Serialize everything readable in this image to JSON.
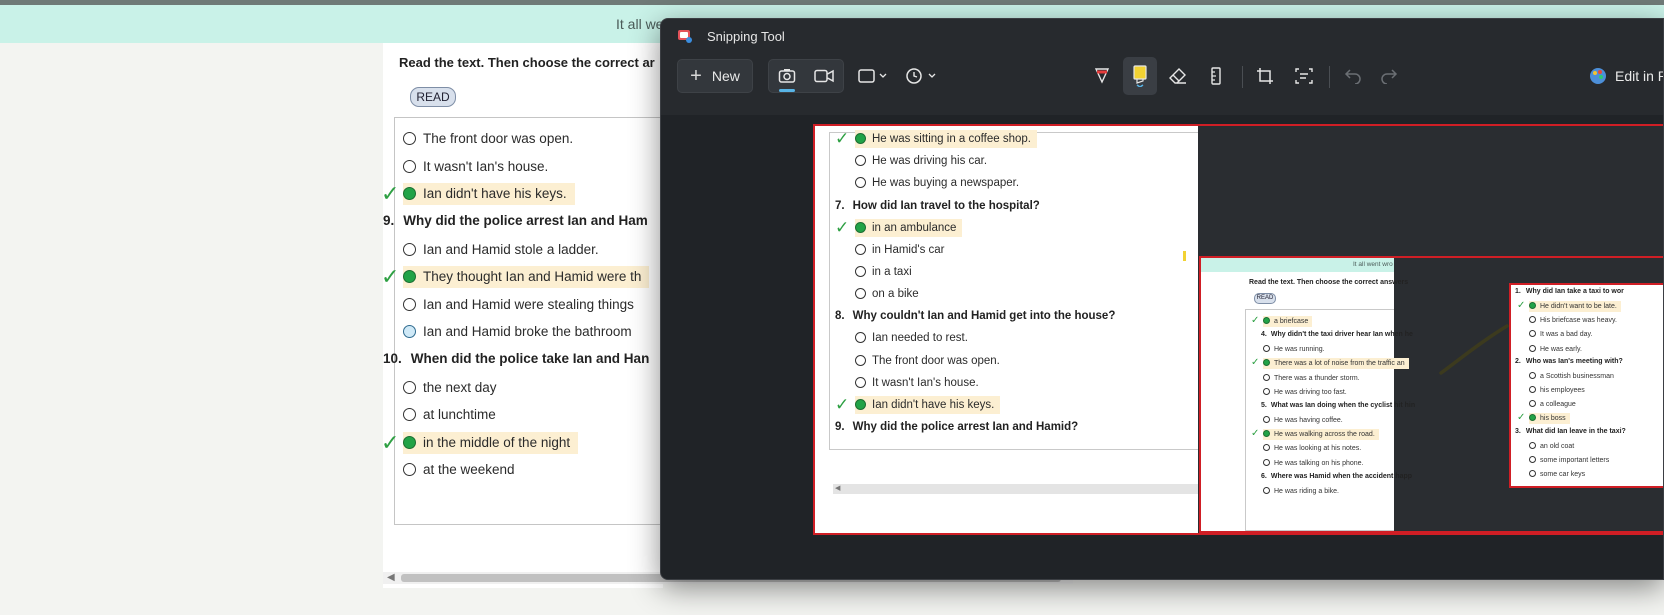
{
  "background_page": {
    "banner_text": "It all we",
    "instruction": "Read the text. Then choose the correct ar",
    "read_button": "READ",
    "items": [
      {
        "type": "option",
        "text": "The front door was open.",
        "state": "empty"
      },
      {
        "type": "option",
        "text": "It wasn't Ian's house.",
        "state": "empty"
      },
      {
        "type": "option",
        "text": "Ian didn't have his keys.",
        "state": "correct"
      },
      {
        "type": "question",
        "num": "9.",
        "text": "Why did the police arrest Ian and Ham"
      },
      {
        "type": "option",
        "text": "Ian and Hamid stole a ladder.",
        "state": "empty"
      },
      {
        "type": "option",
        "text": "They thought Ian and Hamid were th",
        "state": "correct"
      },
      {
        "type": "option",
        "text": "Ian and Hamid were stealing things",
        "state": "empty"
      },
      {
        "type": "option",
        "text": "Ian and Hamid broke the bathroom",
        "state": "focus"
      },
      {
        "type": "question",
        "num": "10.",
        "text": "When did the police take Ian and Han"
      },
      {
        "type": "option",
        "text": "the next day",
        "state": "empty"
      },
      {
        "type": "option",
        "text": "at lunchtime",
        "state": "empty"
      },
      {
        "type": "option",
        "text": "in the middle of the night",
        "state": "correct"
      },
      {
        "type": "option",
        "text": "at the weekend",
        "state": "empty"
      }
    ]
  },
  "snipping_tool": {
    "title": "Snipping Tool",
    "new_label": "New",
    "edit_label": "Edit in P",
    "icons": [
      "snipping-tool-app-icon",
      "screenshot-mode-icon",
      "video-mode-icon",
      "rectangle-snip-icon",
      "chevron-down-icon",
      "delay-timer-icon",
      "ballpoint-pen-icon",
      "highlighter-icon",
      "eraser-icon",
      "ruler-icon",
      "crop-icon",
      "text-actions-icon",
      "undo-icon",
      "redo-icon",
      "paint-app-icon"
    ],
    "captured": {
      "items": [
        {
          "type": "option",
          "text": "He was sitting in a coffee shop.",
          "state": "correct"
        },
        {
          "type": "option",
          "text": "He was driving his car.",
          "state": "empty"
        },
        {
          "type": "option",
          "text": "He was buying a newspaper.",
          "state": "empty"
        },
        {
          "type": "question",
          "num": "7.",
          "text": "How did Ian travel to the hospital?"
        },
        {
          "type": "option",
          "text": "in an ambulance",
          "state": "correct"
        },
        {
          "type": "option",
          "text": "in Hamid's car",
          "state": "empty"
        },
        {
          "type": "option",
          "text": "in a taxi",
          "state": "empty"
        },
        {
          "type": "option",
          "text": "on a bike",
          "state": "empty"
        },
        {
          "type": "question",
          "num": "8.",
          "text": "Why couldn't Ian and Hamid get into the house?"
        },
        {
          "type": "option",
          "text": "Ian needed to rest.",
          "state": "empty"
        },
        {
          "type": "option",
          "text": "The front door was open.",
          "state": "empty"
        },
        {
          "type": "option",
          "text": "It wasn't Ian's house.",
          "state": "empty"
        },
        {
          "type": "option",
          "text": "Ian didn't have his keys.",
          "state": "correct"
        },
        {
          "type": "question",
          "num": "9.",
          "text": "Why did the police arrest Ian and Hamid?"
        }
      ],
      "nested": {
        "banner_text": "It all went wro",
        "instruction": "Read the text. Then choose the correct answers",
        "read_button": "READ",
        "left_items": [
          {
            "type": "option",
            "text": "a briefcase",
            "state": "correct"
          },
          {
            "type": "question",
            "num": "4.",
            "text": "Why didn't the taxi driver hear Ian when he"
          },
          {
            "type": "option",
            "text": "He was running.",
            "state": "empty"
          },
          {
            "type": "option",
            "text": "There was a lot of noise from the traffic an",
            "state": "correct"
          },
          {
            "type": "option",
            "text": "There was a thunder storm.",
            "state": "empty"
          },
          {
            "type": "option",
            "text": "He was driving too fast.",
            "state": "empty"
          },
          {
            "type": "question",
            "num": "5.",
            "text": "What was Ian doing when the cyclist hit hin"
          },
          {
            "type": "option",
            "text": "He was having coffee.",
            "state": "empty"
          },
          {
            "type": "option",
            "text": "He was walking across the road.",
            "state": "correct"
          },
          {
            "type": "option",
            "text": "He was looking at his notes.",
            "state": "empty"
          },
          {
            "type": "option",
            "text": "He was talking on his phone.",
            "state": "empty"
          },
          {
            "type": "question",
            "num": "6.",
            "text": "Where was Hamid when the accident happ"
          },
          {
            "type": "option",
            "text": "He was riding a bike.",
            "state": "empty"
          }
        ],
        "right_items": [
          {
            "type": "question",
            "num": "1.",
            "text": "Why did Ian take a taxi to wor"
          },
          {
            "type": "option",
            "text": "He didn't want to be late.",
            "state": "correct"
          },
          {
            "type": "option",
            "text": "His briefcase was heavy.",
            "state": "empty"
          },
          {
            "type": "option",
            "text": "It was a bad day.",
            "state": "empty"
          },
          {
            "type": "option",
            "text": "He was early.",
            "state": "empty"
          },
          {
            "type": "question",
            "num": "2.",
            "text": "Who was Ian's meeting with?"
          },
          {
            "type": "option",
            "text": "a Scottish businessman",
            "state": "empty"
          },
          {
            "type": "option",
            "text": "his employees",
            "state": "empty"
          },
          {
            "type": "option",
            "text": "a colleague",
            "state": "empty"
          },
          {
            "type": "option",
            "text": "his boss",
            "state": "correct"
          },
          {
            "type": "question",
            "num": "3.",
            "text": "What did Ian leave in the taxi?"
          },
          {
            "type": "option",
            "text": "an old coat",
            "state": "empty"
          },
          {
            "type": "option",
            "text": "some important letters",
            "state": "empty"
          },
          {
            "type": "option",
            "text": "some car keys",
            "state": "empty"
          }
        ]
      }
    }
  },
  "colors": {
    "accent_green": "#22a347",
    "highlight": "#fcefd2",
    "snip_border": "#d01e25",
    "banner": "#c9f2e8"
  }
}
